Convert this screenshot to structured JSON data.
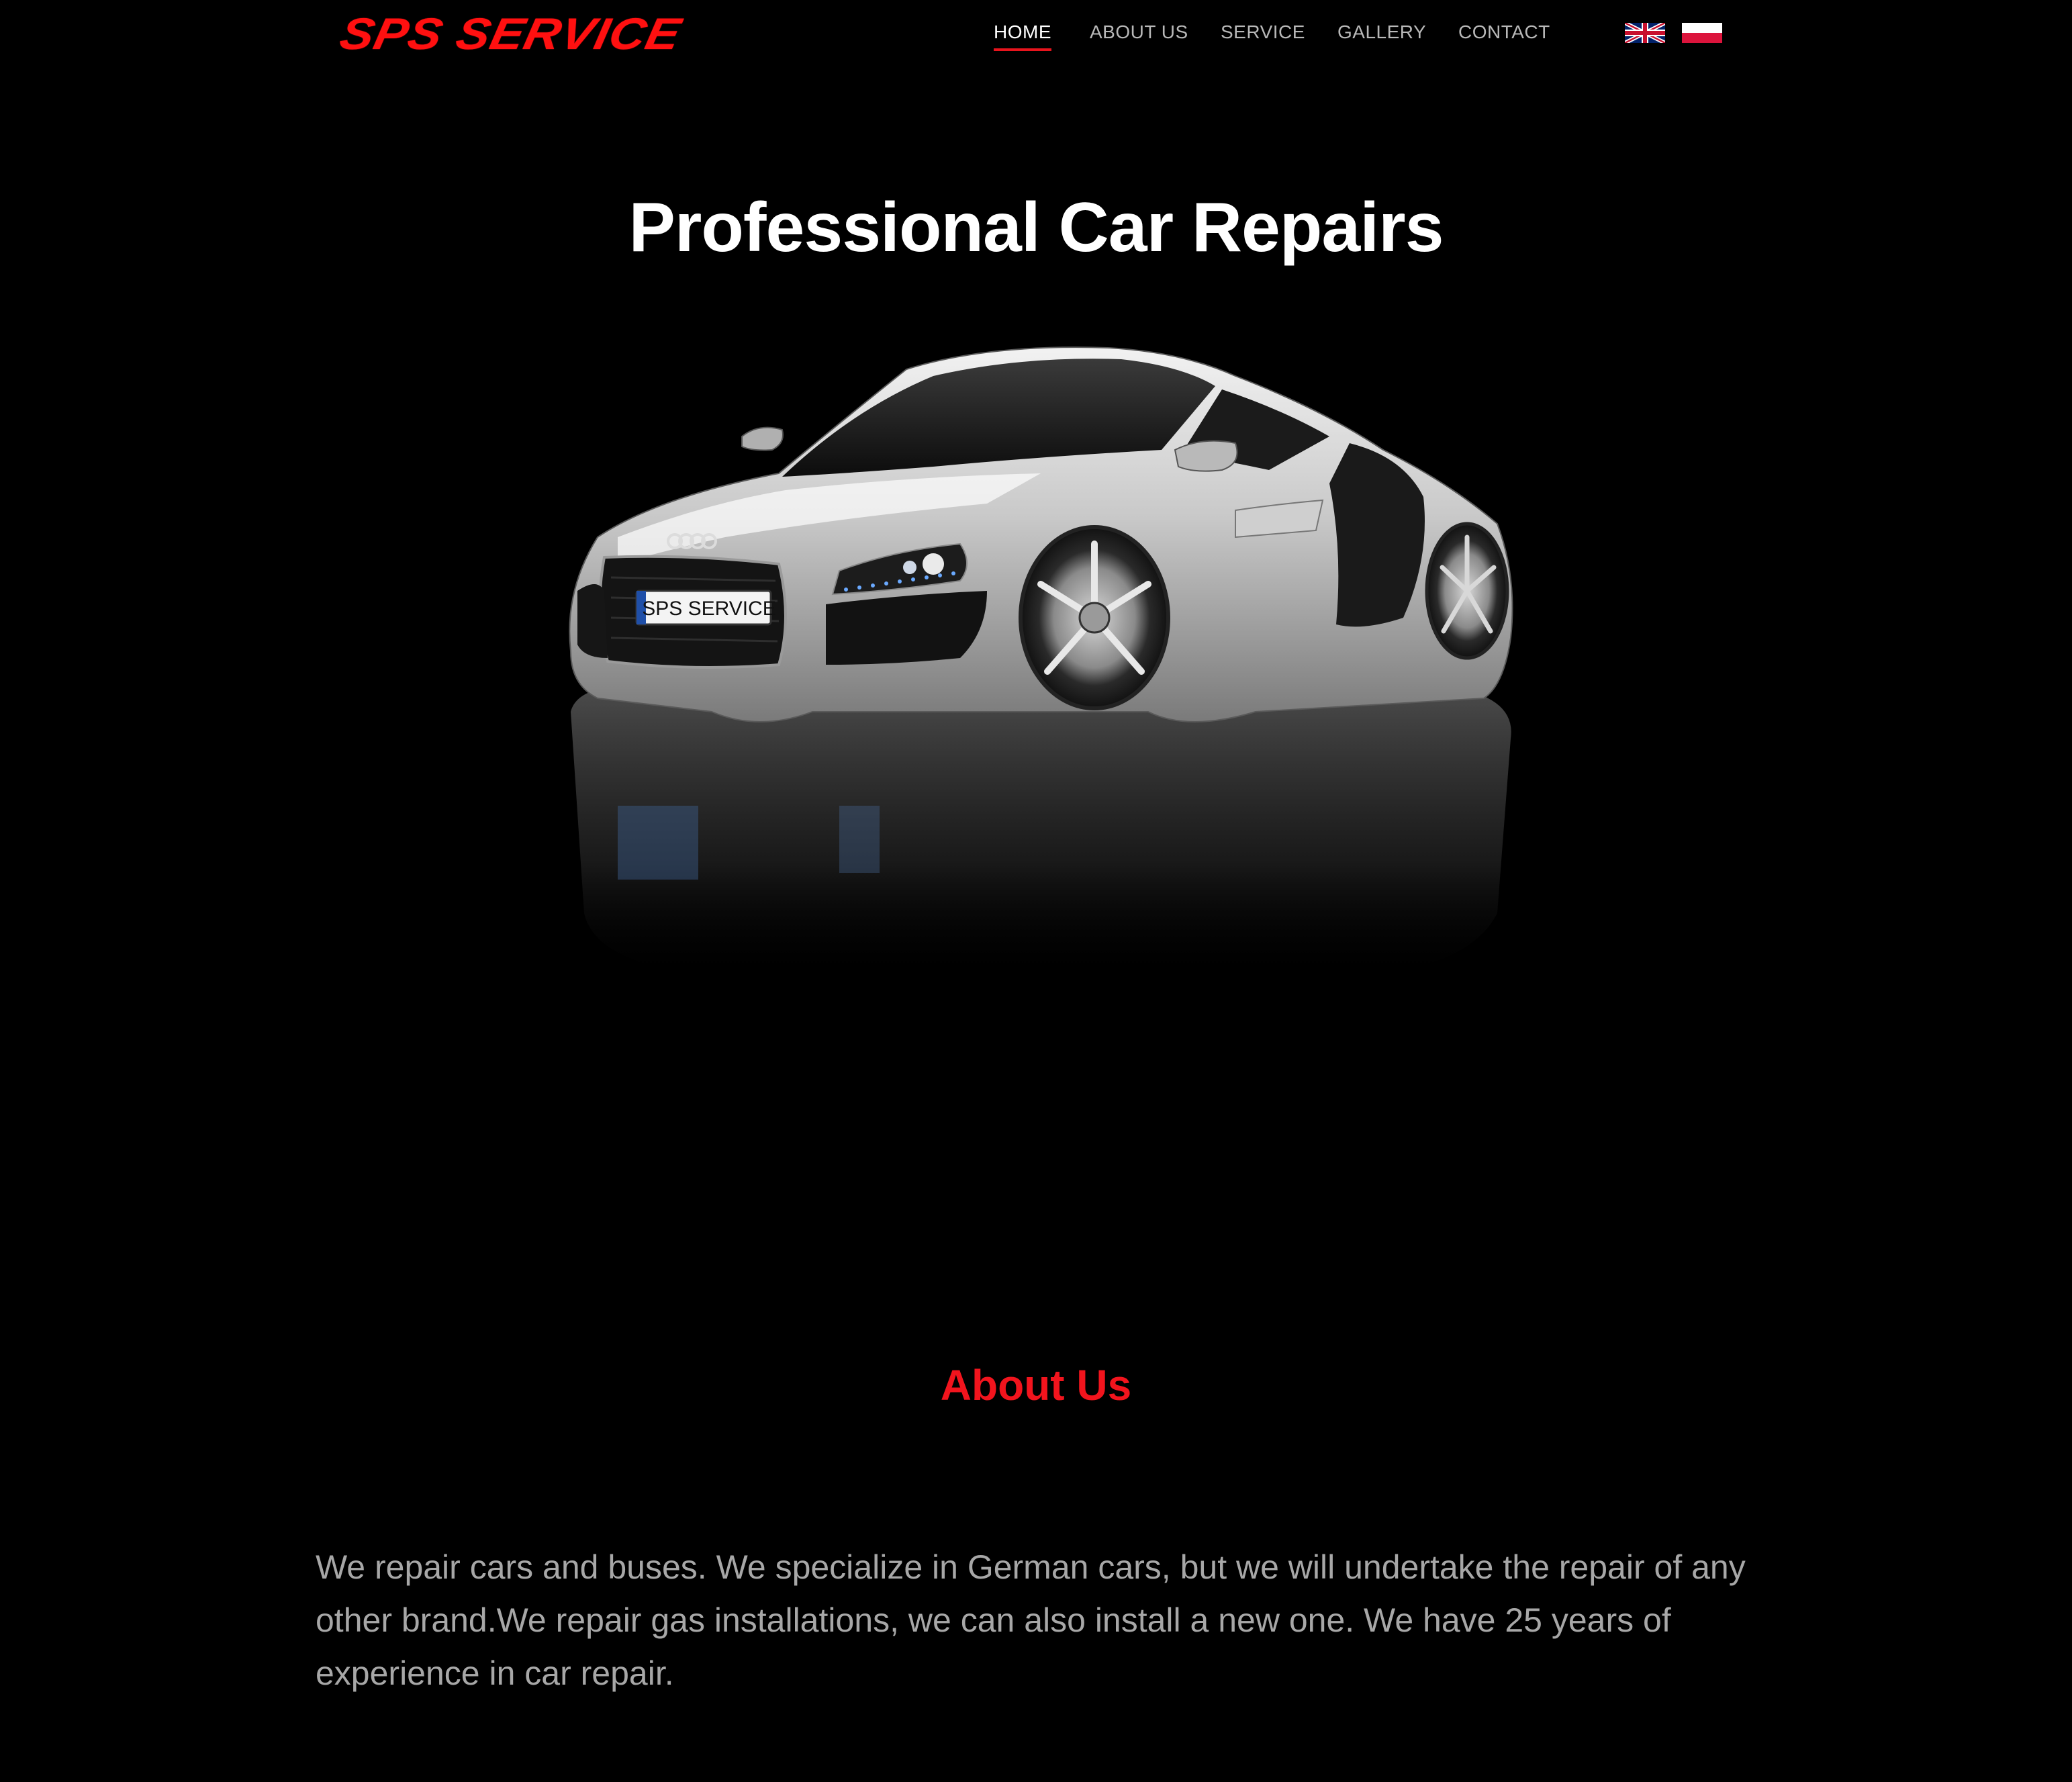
{
  "header": {
    "logo_text": "SPS SERVICE",
    "nav": [
      {
        "label": "HOME",
        "active": true
      },
      {
        "label": "ABOUT US",
        "active": false
      },
      {
        "label": "SERVICE",
        "active": false
      },
      {
        "label": "GALLERY",
        "active": false
      },
      {
        "label": "CONTACT",
        "active": false
      }
    ],
    "languages": [
      "english-flag-icon",
      "polish-flag-icon"
    ]
  },
  "hero": {
    "title": "Professional Car Repairs",
    "car_plate": "SPS SERVICE"
  },
  "about": {
    "title": "About Us",
    "text": "We repair cars and buses. We specialize in German cars, but we will undertake the repair of any other brand.We repair gas installations, we can also install a new one. We have 25 years of experience in car repair."
  },
  "colors": {
    "accent": "#ff1010",
    "background": "#000000",
    "nav_text": "#b8b8b8",
    "body_text": "#a7a7a7"
  }
}
